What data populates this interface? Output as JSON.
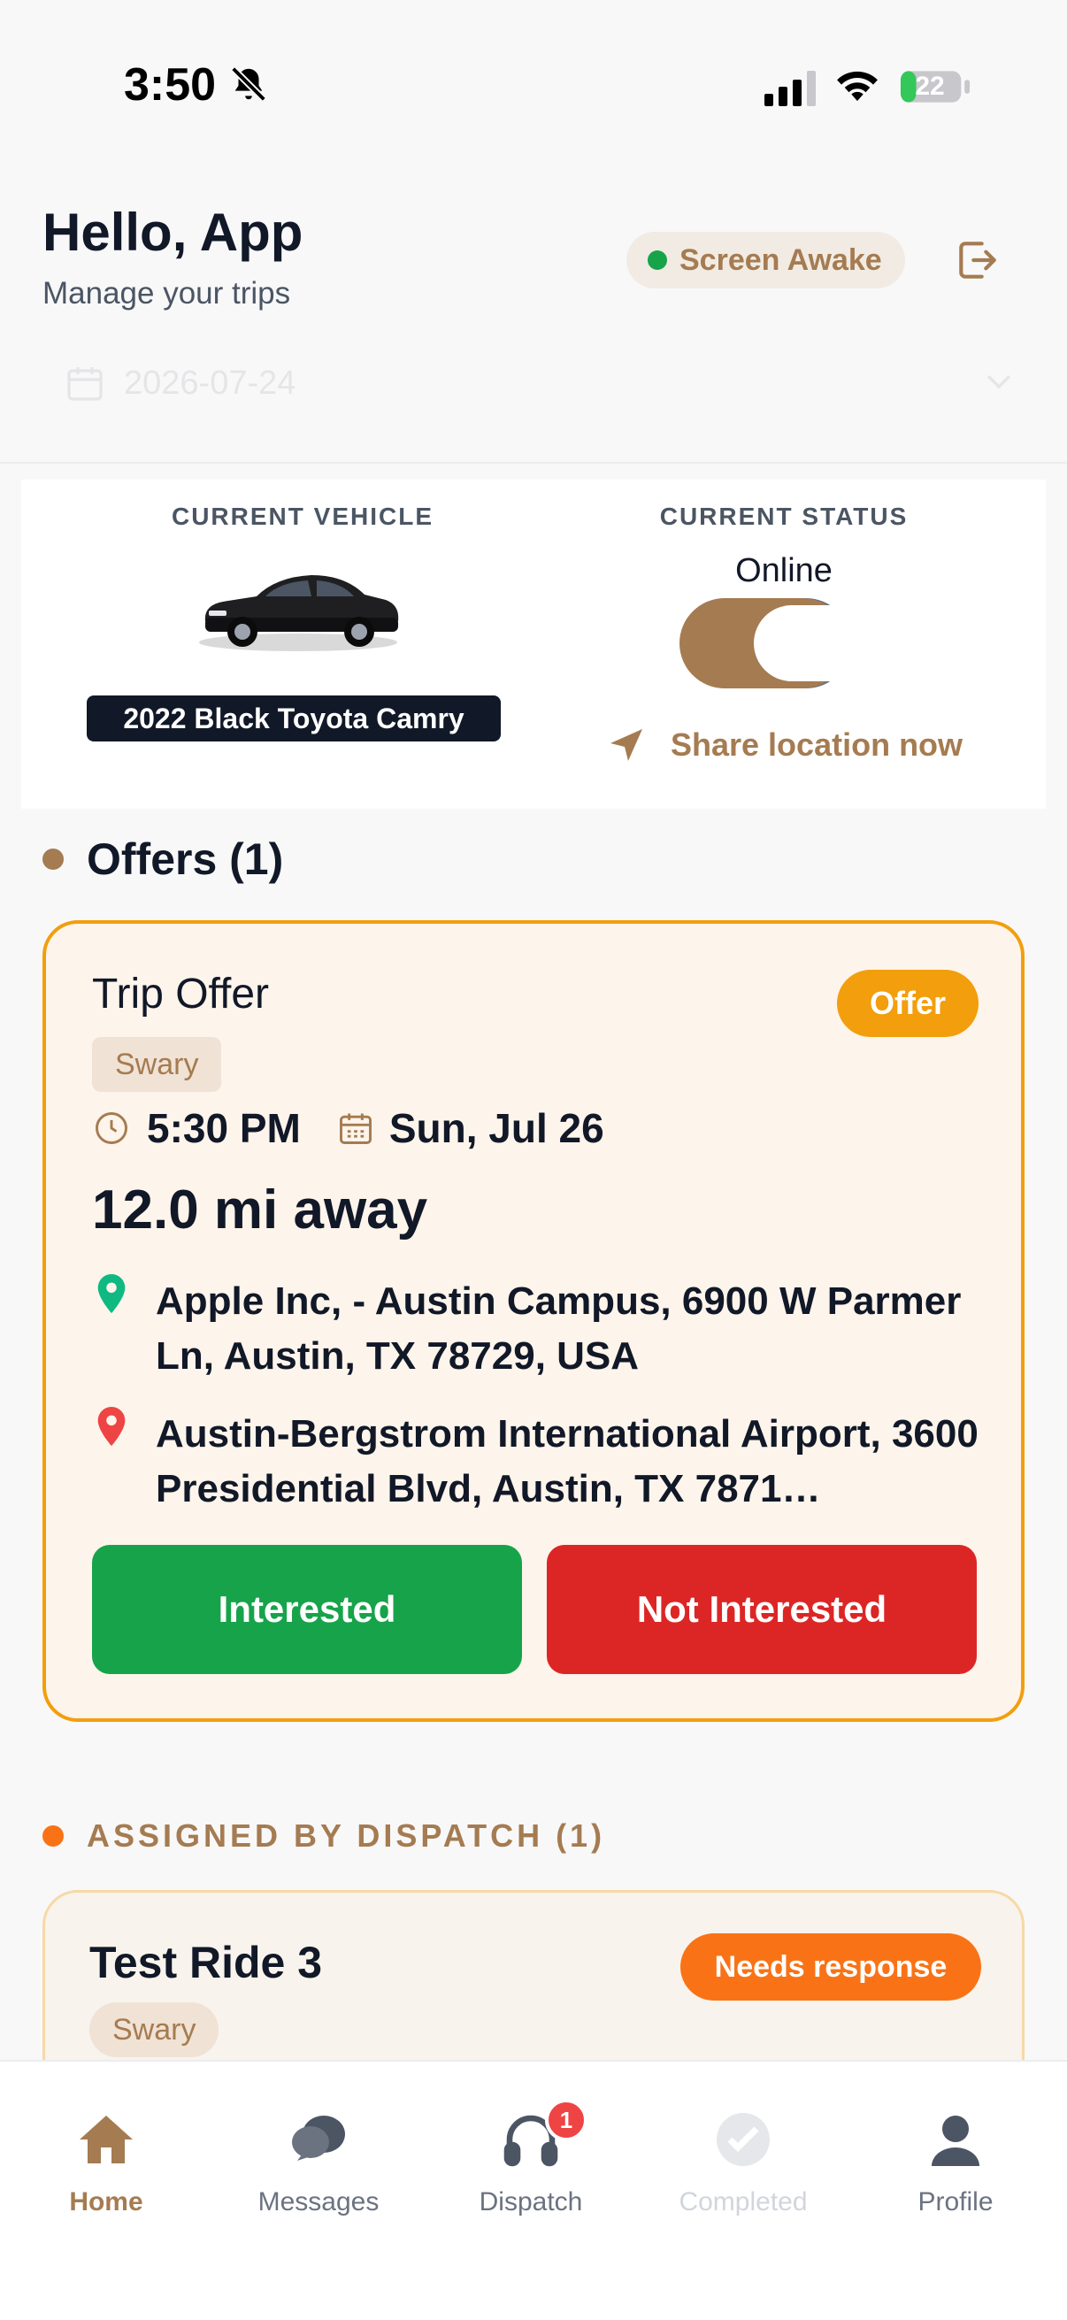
{
  "status_bar": {
    "time": "3:50",
    "battery": "22"
  },
  "header": {
    "greeting": "Hello, App",
    "subtitle": "Manage your trips",
    "screen_awake_label": "Screen Awake",
    "date_value": "2026-07-24"
  },
  "vehicle": {
    "section_label": "CURRENT VEHICLE",
    "name": "2022 Black Toyota Camry"
  },
  "status": {
    "section_label": "CURRENT STATUS",
    "value": "Online",
    "share_location_label": "Share location now"
  },
  "offers": {
    "section_title": "Offers (1)",
    "items": [
      {
        "title": "Trip Offer",
        "badge": "Offer",
        "tag": "Swary",
        "time": "5:30 PM",
        "date": "Sun, Jul 26",
        "distance": "12.0 mi away",
        "pickup": "Apple Inc, - Austin Campus, 6900 W Parmer Ln, Austin, TX 78729, USA",
        "dropoff": "Austin-Bergstrom International Airport, 3600 Presidential Blvd, Austin, TX 7871…",
        "accept_label": "Interested",
        "decline_label": "Not Interested"
      }
    ]
  },
  "assigned": {
    "section_title": "ASSIGNED BY DISPATCH (1)",
    "items": [
      {
        "title": "Test Ride 3",
        "badge": "Needs response",
        "tag": "Swary"
      }
    ]
  },
  "tabbar": {
    "items": [
      {
        "label": "Home",
        "icon": "home-icon"
      },
      {
        "label": "Messages",
        "icon": "chat-bubbles-icon"
      },
      {
        "label": "Dispatch",
        "icon": "headset-icon",
        "badge": "1"
      },
      {
        "label": "Completed",
        "icon": "check-circle-icon"
      },
      {
        "label": "Profile",
        "icon": "person-icon"
      }
    ]
  },
  "colors": {
    "brand": "#a57b51",
    "offer_accent": "#f29e0d",
    "accept": "#17a34a",
    "decline": "#dc2626",
    "needs_response": "#f97316",
    "online_dot": "#16a34a"
  }
}
